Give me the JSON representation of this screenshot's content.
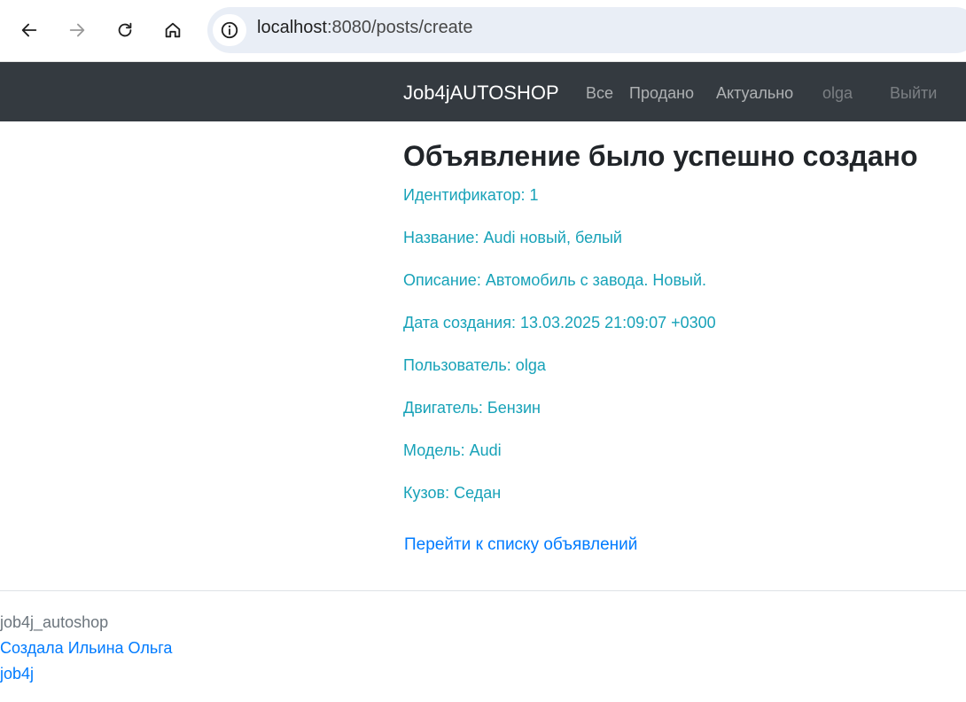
{
  "browser": {
    "url_host": "localhost",
    "url_path": ":8080/posts/create"
  },
  "navbar": {
    "brand": "Job4jAUTOSHOP",
    "links": [
      "Все",
      "Продано",
      "Актуально"
    ],
    "user": "olga",
    "logout": "Выйти"
  },
  "main": {
    "title": "Объявление было успешно создано",
    "details": [
      "Идентификатор: 1",
      "Название: Audi новый, белый",
      "Описание: Автомобиль с завода. Новый.",
      "Дата создания: 13.03.2025 21:09:07 +0300",
      "Пользователь: olga",
      "Двигатель: Бензин",
      "Модель: Audi",
      "Кузов: Седан"
    ],
    "back_link": "Перейти к списку объявлений"
  },
  "footer": {
    "project": "job4j_autoshop",
    "author": "Создала Ильина Ольга",
    "school": "job4j"
  },
  "colors": {
    "navbar_bg": "#343a40",
    "detail_text": "#17a2b8",
    "link": "#007bff"
  }
}
